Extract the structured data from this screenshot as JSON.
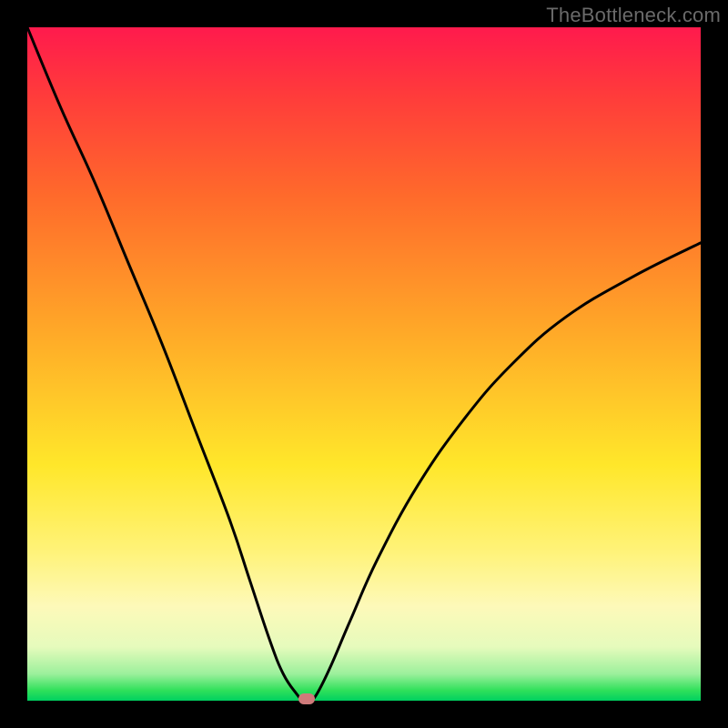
{
  "watermark": "TheBottleneck.com",
  "chart_data": {
    "type": "line",
    "title": "",
    "xlabel": "",
    "ylabel": "",
    "xlim": [
      0,
      100
    ],
    "ylim": [
      0,
      100
    ],
    "grid": false,
    "legend": false,
    "background_gradient": {
      "top": "#ff1a4d",
      "mid": "#ffe72a",
      "bottom": "#00d060"
    },
    "series": [
      {
        "name": "bottleneck-curve",
        "color": "#000000",
        "x": [
          0,
          5,
          10,
          15,
          20,
          25,
          30,
          33,
          36,
          38,
          40,
          41,
          42,
          43,
          45,
          48,
          52,
          58,
          65,
          72,
          80,
          90,
          100
        ],
        "y": [
          100,
          88,
          77,
          65,
          53,
          40,
          27,
          18,
          9,
          4,
          1,
          0,
          0,
          1,
          5,
          12,
          21,
          32,
          42,
          50,
          57,
          63,
          68
        ]
      }
    ],
    "marker": {
      "name": "optimal-point",
      "x": 41.5,
      "y": 0,
      "color": "#cf7a7a"
    }
  }
}
